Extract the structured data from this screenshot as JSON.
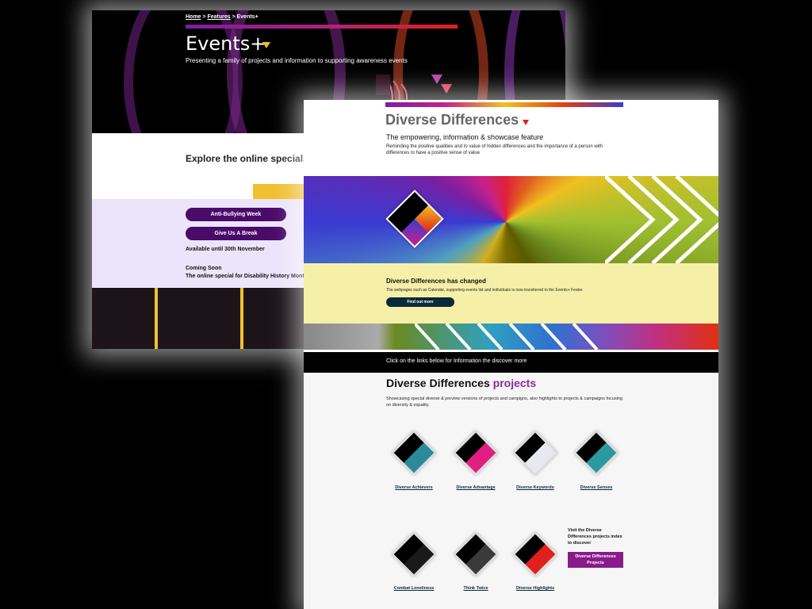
{
  "events": {
    "breadcrumb": {
      "home": "Home",
      "sep1": " > ",
      "features": "Features",
      "sep2": " > ",
      "current": "Events+"
    },
    "title": "Events+",
    "subtitle": "Presenting a family of projects and information to supporting awareness events",
    "explore_heading": "Explore the online specials",
    "buttons": [
      "Anti-Bullying Week",
      "Give Us A Break"
    ],
    "available": "Available until 30th November",
    "coming_soon": "Coming Soon",
    "coming_soon_detail": "The online special for Disability History Month"
  },
  "diverse": {
    "title": "Diverse Differences",
    "subtitle": "The empowering, information & showcase feature",
    "description": "Reminding the positive qualities and to value of hidden differences and the importance of a person with differences to have a positive sense of value",
    "changed_heading": "Diverse Differences has changed",
    "changed_text": "The webpages such as Calendar, supporting events list and individuals is now transferred to the Events+ Featre",
    "find_out_more": "Find out more",
    "links_bar": "Click on the links below for Information the discover more",
    "projects_title_main": "Diverse Differences",
    "projects_title_accent": "projects",
    "projects_desc": "Showcasing special diverse & preview versions of projects and campigns, also highlights to projects & campaigns focusing on diversity & equality.",
    "tiles": [
      {
        "label": "Diverse Achievers",
        "icon": "achievers-icon"
      },
      {
        "label": "Diverse Advantage",
        "icon": "advantage-icon"
      },
      {
        "label": "Diverse Keywords",
        "icon": "keywords-icon"
      },
      {
        "label": "Diverse Senses",
        "icon": "senses-icon"
      },
      {
        "label": "Combat Loneliness",
        "icon": "loneliness-icon"
      },
      {
        "label": "Think Twice",
        "icon": "exclamation-icon"
      },
      {
        "label": "Diverse Highlights",
        "icon": "highlights-icon"
      }
    ],
    "visit_text": "Visit the Diverse Differences projects index to discover",
    "visit_button": "Diverse Differences Projects"
  },
  "colors": {
    "purple": "#4a0a6a",
    "accent": "#8a2a9a",
    "yellow": "#f0c030",
    "navy_button": "#0a2a3a",
    "magenta_button": "#8a1a8a"
  }
}
